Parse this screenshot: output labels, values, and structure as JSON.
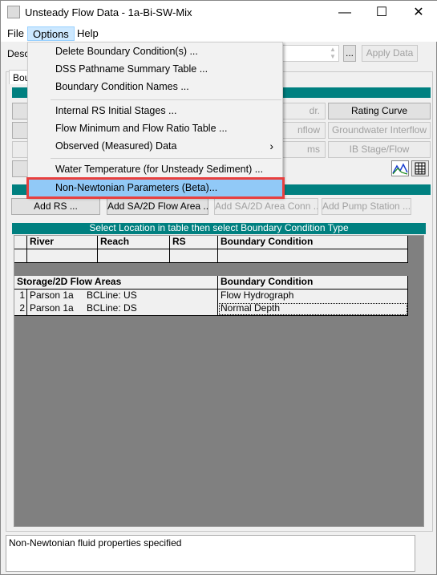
{
  "window": {
    "title": "Unsteady Flow Data - 1a-Bi-SW-Mix",
    "minimize": "—",
    "maximize": "☐",
    "close": "✕"
  },
  "menubar": [
    "File",
    "Options",
    "Help"
  ],
  "description": {
    "label": "Desc",
    "value": "",
    "browse": "...",
    "apply": "Apply Data"
  },
  "tab": "Bou",
  "buttons": {
    "row1": [
      "dr.",
      "Rating Curve"
    ],
    "row2": [
      "nflow",
      "Groundwater Interflow"
    ],
    "row3": [
      "ms",
      "IB Stage/Flow"
    ]
  },
  "icons": [
    "hydrograph-plot-icon",
    "table-icon"
  ],
  "add_buttons": [
    "Add RS ...",
    "Add SA/2D Flow Area ...",
    "Add SA/2D Area Conn ...",
    "Add Pump Station ..."
  ],
  "table_banner": "Select Location in table then select Boundary Condition Type",
  "river_table": {
    "headers": [
      "River",
      "Reach",
      "RS",
      "Boundary Condition"
    ]
  },
  "storage_table": {
    "headers": [
      "Storage/2D Flow Areas",
      "Boundary Condition"
    ],
    "rows": [
      {
        "n": "1",
        "area": "Parson 1a",
        "line": "BCLine: US",
        "bc": "Flow Hydrograph"
      },
      {
        "n": "2",
        "area": "Parson 1a",
        "line": "BCLine: DS",
        "bc": "Normal Depth"
      }
    ]
  },
  "options_menu": [
    "Delete Boundary Condition(s) ...",
    "DSS Pathname Summary Table ...",
    "Boundary Condition Names ...",
    "Internal RS Initial Stages ...",
    "Flow Minimum and Flow Ratio Table ...",
    "Observed (Measured) Data",
    "Water Temperature (for Unsteady Sediment) ...",
    "Non-Newtonian Parameters (Beta)..."
  ],
  "submenu_arrow": "›",
  "status": "Non-Newtonian fluid properties specified",
  "colors": {
    "teal": "#008080",
    "highlight": "#91c9f7",
    "callout": "#e8403f"
  }
}
